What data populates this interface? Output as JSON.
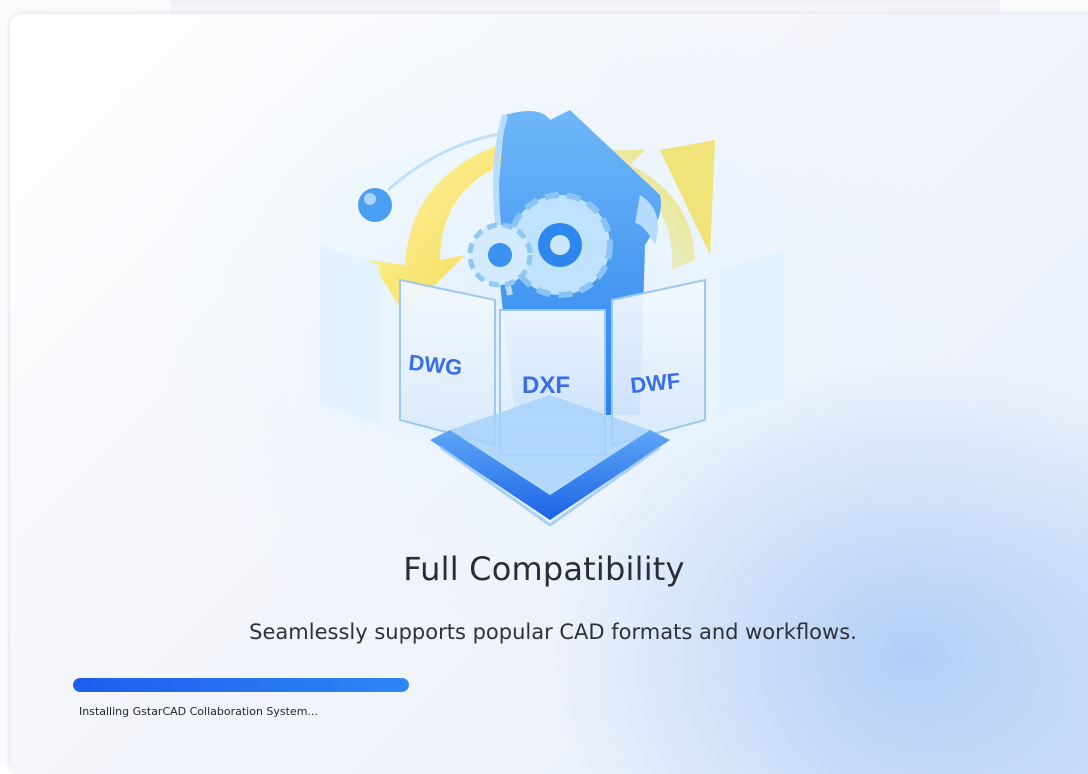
{
  "hero": {
    "format_labels": [
      "DWG",
      "DXF",
      "DWF"
    ]
  },
  "headline": "Full Compatibility",
  "subline": "Seamlessly supports popular CAD formats and workflows.",
  "progress": {
    "fraction": 1.0,
    "status_text": "Installing GstarCAD Collaboration System..."
  },
  "colors": {
    "accent": "#1f5cf0",
    "headline": "#2a2d36",
    "format_label": "#3a6ee8"
  }
}
